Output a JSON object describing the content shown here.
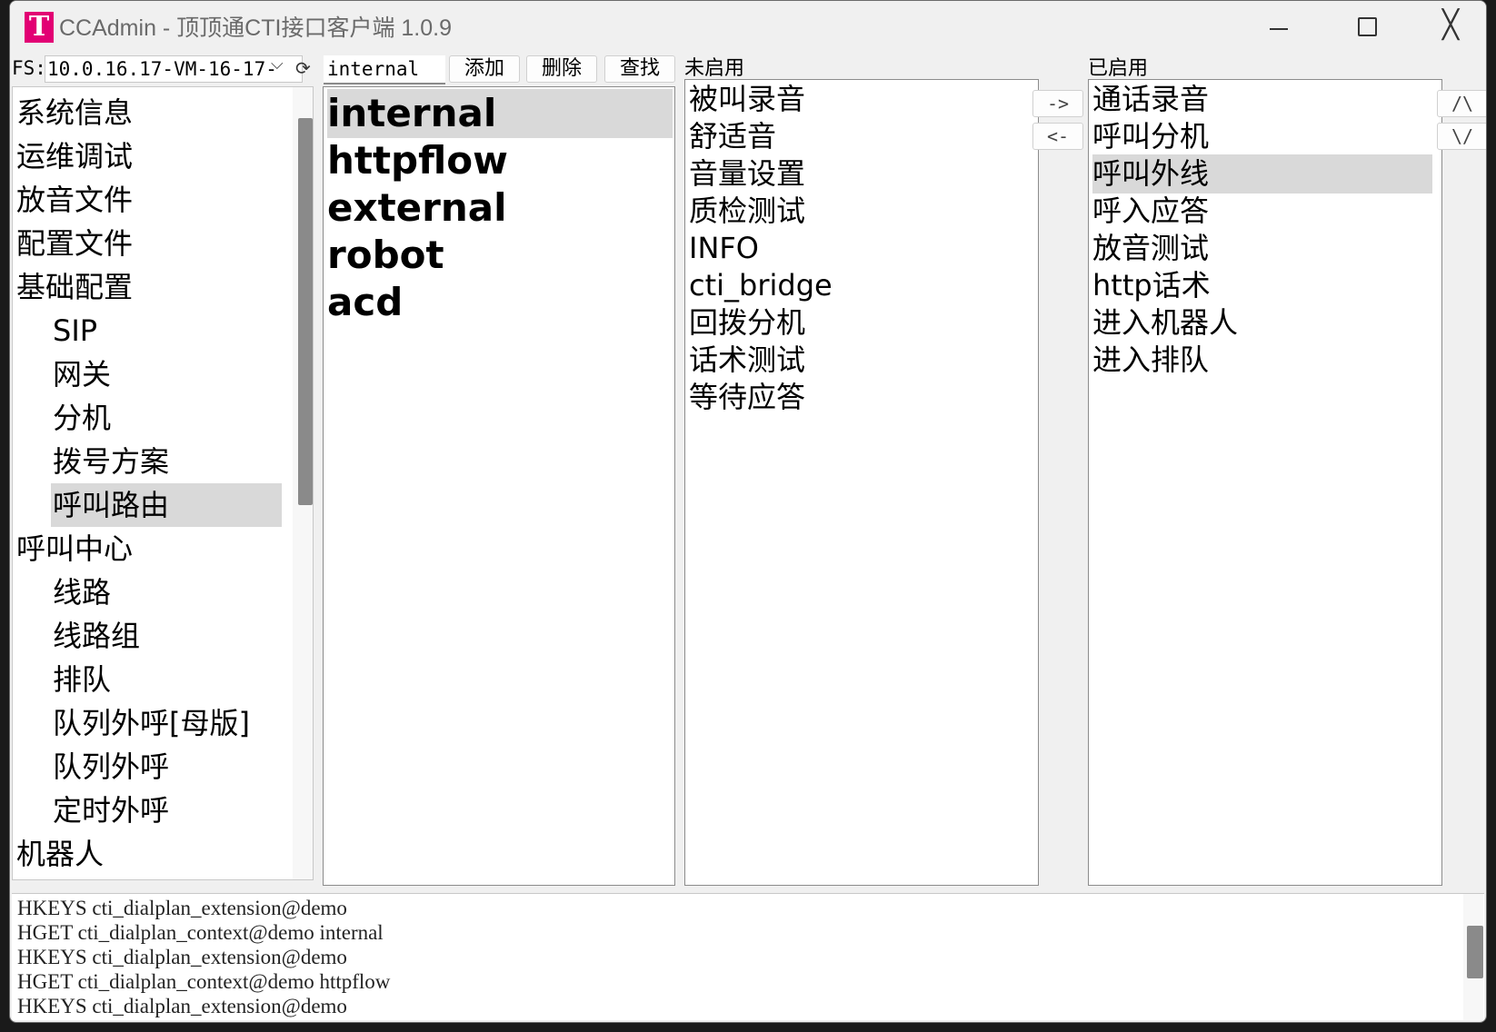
{
  "window": {
    "logo_text": "T",
    "title": "CCAdmin - 顶顶通CTI接口客户端 1.0.9",
    "close_symbol": "╳"
  },
  "toolbar": {
    "fs_label": "FS:",
    "fs_value": "10.0.16.17-VM-16-17-",
    "chevron": "⌵",
    "refresh": "⟳",
    "context_value": "internal",
    "add_label": "添加",
    "delete_label": "删除",
    "find_label": "查找"
  },
  "tree": {
    "items": [
      {
        "label": "系统信息"
      },
      {
        "label": "运维调试"
      },
      {
        "label": "放音文件"
      },
      {
        "label": "配置文件"
      },
      {
        "label": "基础配置"
      },
      {
        "label": "SIP"
      },
      {
        "label": "网关"
      },
      {
        "label": "分机"
      },
      {
        "label": "拨号方案"
      },
      {
        "label": "呼叫路由"
      },
      {
        "label": "呼叫中心"
      },
      {
        "label": "线路"
      },
      {
        "label": "线路组"
      },
      {
        "label": "排队"
      },
      {
        "label": "队列外呼[母版]"
      },
      {
        "label": "队列外呼"
      },
      {
        "label": "定时外呼"
      },
      {
        "label": "机器人"
      }
    ],
    "selected": "呼叫路由"
  },
  "contexts": {
    "items": [
      "internal",
      "httpflow",
      "external",
      "robot",
      "acd"
    ],
    "selected": "internal"
  },
  "disabled_apps": {
    "label": "未启用",
    "items": [
      "被叫录音",
      "舒适音",
      "音量设置",
      "质检测试",
      "INFO",
      "cti_bridge",
      "回拨分机",
      "话术测试",
      "等待应答"
    ]
  },
  "enabled_apps": {
    "label": "已启用",
    "items": [
      "通话录音",
      "呼叫分机",
      "呼叫外线",
      "呼入应答",
      "放音测试",
      "http话术",
      "进入机器人",
      "进入排队"
    ],
    "selected": "呼叫外线"
  },
  "move_buttons": {
    "right": "->",
    "left": "<-",
    "up": "/\\",
    "down": "\\/"
  },
  "log": {
    "lines": [
      "HKEYS cti_dialplan_extension@demo",
      "HGET cti_dialplan_context@demo internal",
      "HKEYS cti_dialplan_extension@demo",
      "HGET cti_dialplan_context@demo httpflow",
      "HKEYS cti_dialplan_extension@demo"
    ]
  }
}
